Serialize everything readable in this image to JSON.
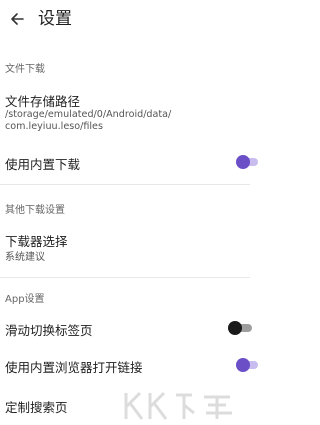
{
  "app_bar": {
    "back_icon": "arrow-left-icon",
    "title": "设置"
  },
  "sections": {
    "download": {
      "header": "文件下载",
      "storage_path_title": "文件存储路径",
      "storage_path_line1": "/storage/emulated/0/Android/data/",
      "storage_path_line2": "com.leyiuu.leso/files",
      "builtin_download_title": "使用内置下载",
      "builtin_download_enabled": true
    },
    "other_download": {
      "header": "其他下载设置",
      "downloader_title": "下载器选择",
      "downloader_value": "系统建议"
    },
    "app": {
      "header": "App设置",
      "swipe_tabs_title": "滑动切换标签页",
      "swipe_tabs_enabled": false,
      "builtin_browser_title": "使用内置浏览器打开链接",
      "builtin_browser_enabled": true,
      "custom_search_title": "定制搜索页"
    }
  },
  "colors": {
    "accent": "#6b4fc7",
    "accent_track": "#c9bdf0",
    "off_thumb": "#1a1a1a",
    "off_track": "#9e9e9e"
  }
}
